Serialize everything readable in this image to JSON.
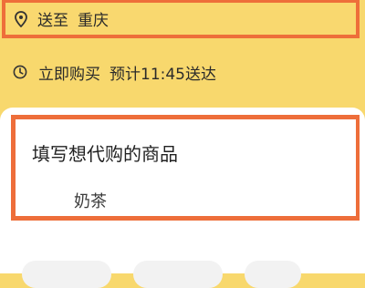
{
  "address": {
    "prefix": "送至",
    "city": "重庆"
  },
  "delivery": {
    "mode": "立即购买",
    "eta": "预计11:45送达"
  },
  "item": {
    "title": "填写想代购的商品",
    "value": "奶茶"
  },
  "icons": {
    "address": "location-pin-icon",
    "delivery": "clock-icon"
  },
  "colors": {
    "background": "#f8d86d",
    "highlight_border": "#ee6e3a",
    "card": "#ffffff"
  }
}
